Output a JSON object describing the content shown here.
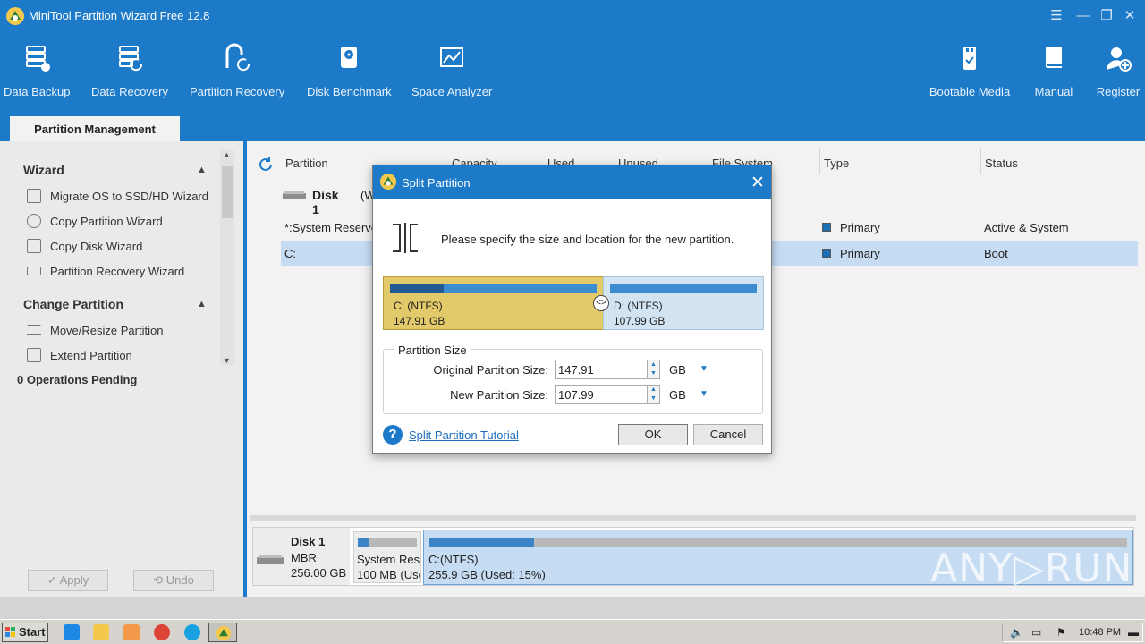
{
  "app": {
    "title": "MiniTool Partition Wizard Free 12.8",
    "window_controls": [
      "☰",
      "—",
      "❐",
      "✕"
    ]
  },
  "toolbar": [
    {
      "label": "Data Backup",
      "icon": "data-backup-icon"
    },
    {
      "label": "Data Recovery",
      "icon": "data-recovery-icon"
    },
    {
      "label": "Partition Recovery",
      "icon": "partition-recovery-icon"
    },
    {
      "label": "Disk Benchmark",
      "icon": "disk-benchmark-icon"
    },
    {
      "label": "Space Analyzer",
      "icon": "space-analyzer-icon"
    },
    {
      "label": "Bootable Media",
      "icon": "bootable-media-icon"
    },
    {
      "label": "Manual",
      "icon": "manual-icon"
    },
    {
      "label": "Register",
      "icon": "register-icon"
    }
  ],
  "tab": {
    "label": "Partition Management"
  },
  "sidebar": {
    "sections": [
      {
        "title": "Wizard",
        "items": [
          "Migrate OS to SSD/HD Wizard",
          "Copy Partition Wizard",
          "Copy Disk Wizard",
          "Partition Recovery Wizard"
        ]
      },
      {
        "title": "Change Partition",
        "items": [
          "Move/Resize Partition",
          "Extend Partition"
        ]
      }
    ],
    "ops_pending": "0 Operations Pending",
    "apply_label": "Apply",
    "undo_label": "Undo"
  },
  "grid": {
    "columns": [
      "Partition",
      "Capacity",
      "Used",
      "Unused",
      "File System",
      "Type",
      "Status"
    ],
    "disk_label": "Disk 1",
    "disk_label_tail": "(WD",
    "rows": [
      {
        "partition": "*:System Reserve",
        "type": "Primary",
        "status": "Active & System",
        "selected": false
      },
      {
        "partition": "C:",
        "type": "Primary",
        "status": "Boot",
        "selected": true
      }
    ]
  },
  "diskmap": {
    "disk_name": "Disk 1",
    "disk_scheme": "MBR",
    "disk_size": "256.00 GB",
    "partitions": [
      {
        "name": "System Rese",
        "detail": "100 MB (Use",
        "used_fraction": 0.2
      },
      {
        "name": "C:(NTFS)",
        "detail": "255.9 GB (Used: 15%)",
        "used_fraction": 0.15
      }
    ]
  },
  "dialog": {
    "title": "Split Partition",
    "message": "Please specify the size and location for the new partition.",
    "left_partition": {
      "name": "C: (NTFS)",
      "size": "147.91 GB",
      "used_fraction": 0.26
    },
    "right_partition": {
      "name": "D: (NTFS)",
      "size": "107.99 GB"
    },
    "group_title": "Partition Size",
    "original_label": "Original Partition Size:",
    "original_value": "147.91",
    "new_label": "New Partition Size:",
    "new_value": "107.99",
    "unit": "GB",
    "tutorial_link": "Split Partition Tutorial",
    "ok_label": "OK",
    "cancel_label": "Cancel"
  },
  "watermark": "ANY▷RUN",
  "taskbar": {
    "start_label": "Start",
    "clock": "10:48 PM",
    "colors": {
      "ie": "#1e88e5",
      "explorer": "#f2c94c",
      "media": "#f2994a",
      "chrome": "#db4437",
      "edge": "#1aa1e0"
    }
  }
}
